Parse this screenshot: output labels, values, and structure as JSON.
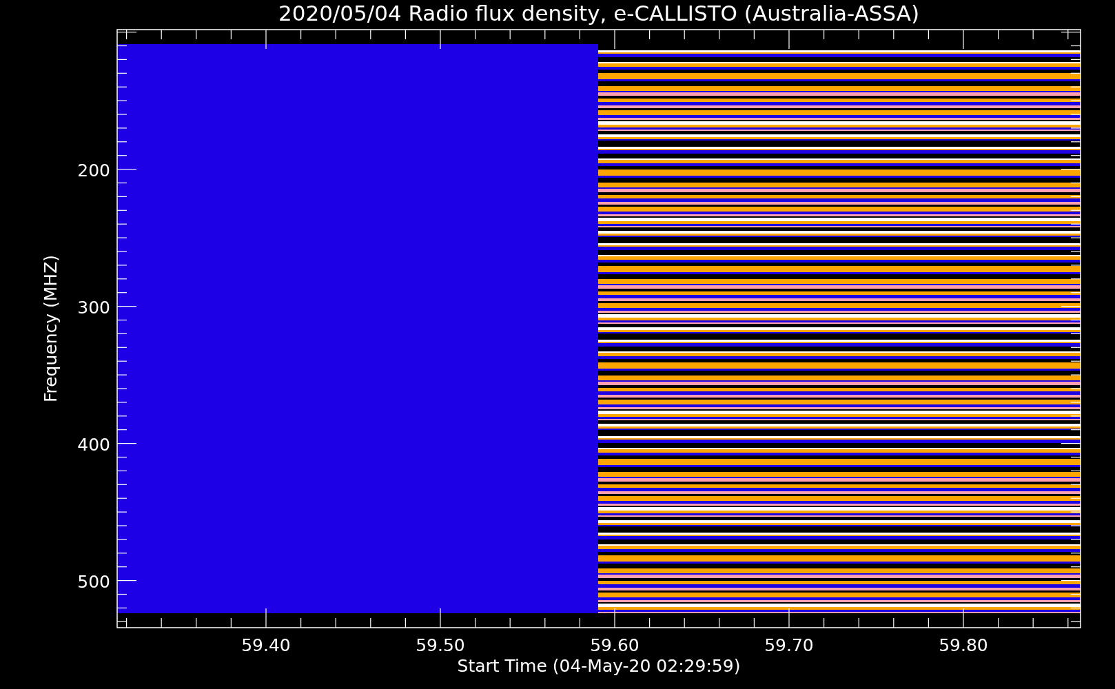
{
  "title": "2020/05/04  Radio flux density, e-CALLISTO (Australia-ASSA)",
  "y_axis": {
    "label": "Frequency (MHZ)",
    "ticks": [
      "200",
      "300",
      "400",
      "500"
    ]
  },
  "x_axis": {
    "label": "Start Time (04-May-20 02:29:59)",
    "ticks": [
      "59.40",
      "59.50",
      "59.60",
      "59.70",
      "59.80"
    ]
  }
}
